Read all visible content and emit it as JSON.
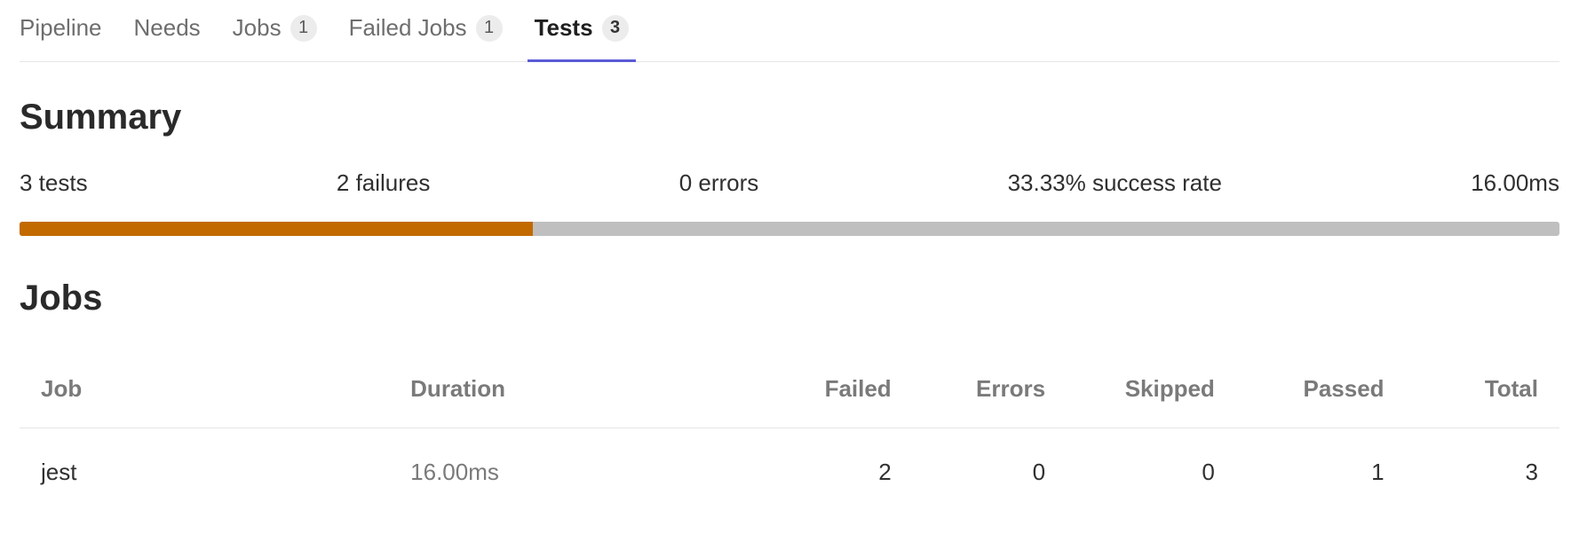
{
  "tabs": {
    "pipeline": {
      "label": "Pipeline",
      "badge": null,
      "active": false
    },
    "needs": {
      "label": "Needs",
      "badge": null,
      "active": false
    },
    "jobs": {
      "label": "Jobs",
      "badge": "1",
      "active": false
    },
    "failed": {
      "label": "Failed Jobs",
      "badge": "1",
      "active": false
    },
    "tests": {
      "label": "Tests",
      "badge": "3",
      "active": true
    }
  },
  "summary": {
    "heading": "Summary",
    "tests": "3 tests",
    "failures": "2 failures",
    "errors": "0 errors",
    "success_rate": "33.33% success rate",
    "duration": "16.00ms",
    "progress_pct": 33.33
  },
  "jobs": {
    "heading": "Jobs",
    "columns": {
      "job": "Job",
      "duration": "Duration",
      "failed": "Failed",
      "errors": "Errors",
      "skipped": "Skipped",
      "passed": "Passed",
      "total": "Total"
    },
    "rows": [
      {
        "job": "jest",
        "duration": "16.00ms",
        "failed": "2",
        "errors": "0",
        "skipped": "0",
        "passed": "1",
        "total": "3"
      }
    ]
  }
}
